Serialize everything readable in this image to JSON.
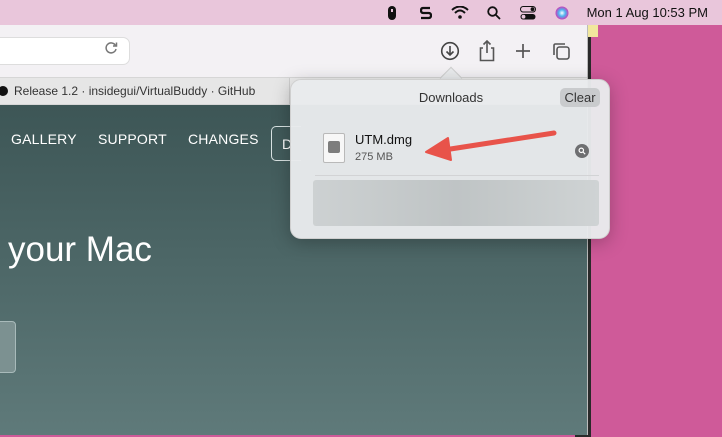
{
  "menubar": {
    "icons": [
      "status-icon",
      "s-app-icon",
      "wifi-icon",
      "search-icon",
      "control-center-icon",
      "siri-icon"
    ],
    "clock": "Mon 1 Aug  10:53 PM"
  },
  "browser": {
    "tab_title": "Release 1.2 · insidegui/VirtualBuddy · GitHub"
  },
  "page": {
    "nav": [
      "GALLERY",
      "SUPPORT",
      "CHANGES",
      "D"
    ],
    "hero": "your Mac"
  },
  "downloads": {
    "title": "Downloads",
    "clear_label": "Clear",
    "items": [
      {
        "name": "UTM.dmg",
        "size": "275 MB"
      }
    ]
  },
  "colors": {
    "desktop": "#cf5a99",
    "page_bg": "#4c6666",
    "arrow": "#e8534a"
  }
}
